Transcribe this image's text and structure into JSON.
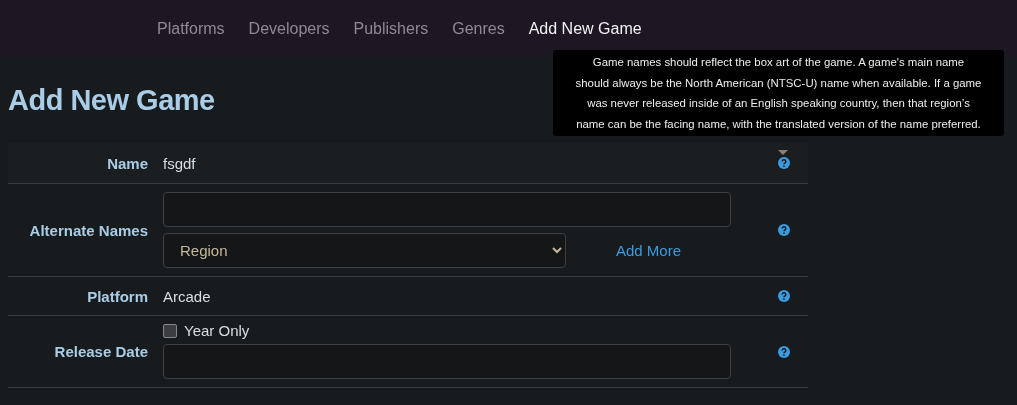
{
  "nav": {
    "items": [
      {
        "label": "Platforms",
        "selected": false
      },
      {
        "label": "Developers",
        "selected": false
      },
      {
        "label": "Publishers",
        "selected": false
      },
      {
        "label": "Genres",
        "selected": false
      },
      {
        "label": "Add New Game",
        "selected": true
      }
    ]
  },
  "title": "Add New Game",
  "tooltip": "Game names should reflect the box art of the game. A game's main name should always be the North American (NTSC-U) name when available. If a game was never released inside of an English speaking country, then that region’s name can be the facing name, with the translated version of the name preferred.",
  "form": {
    "rows": [
      {
        "kind": "static",
        "label": "Name",
        "value": "fsgdf"
      },
      {
        "kind": "alternate",
        "label": "Alternate Names",
        "select": {
          "value": "Region"
        },
        "link": "Add More"
      },
      {
        "kind": "static",
        "label": "Platform",
        "value": "Arcade"
      },
      {
        "kind": "date",
        "label": "Release Date",
        "checkbox": {
          "label": "Year Only",
          "checked": false
        }
      }
    ]
  }
}
